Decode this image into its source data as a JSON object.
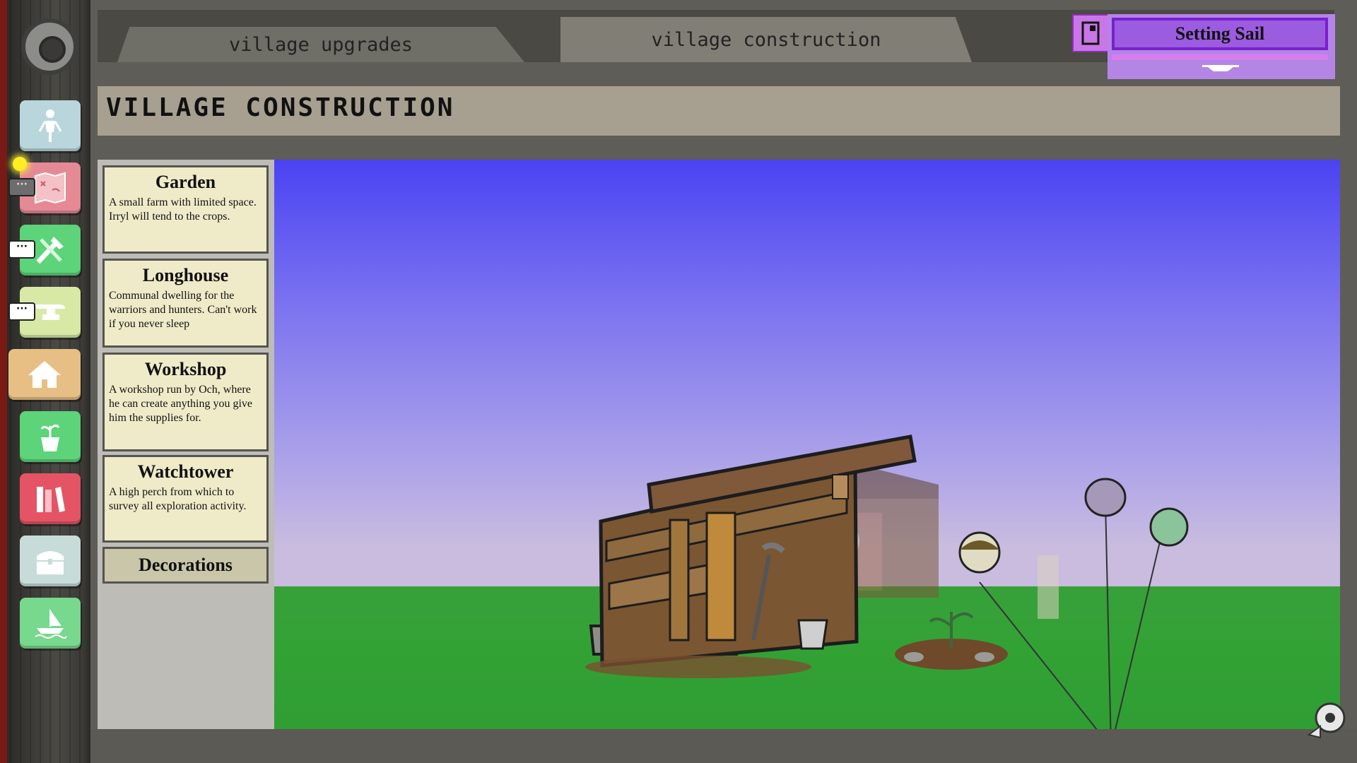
{
  "tabs": {
    "upgrades": "village upgrades",
    "construction": "village construction"
  },
  "quest": {
    "title": "Setting Sail"
  },
  "page": {
    "title": "VILLAGE CONSTRUCTION"
  },
  "buildings": [
    {
      "name": "Garden",
      "description": "A small farm with limited space. Irryl will tend to the crops."
    },
    {
      "name": "Longhouse",
      "description": "Communal dwelling for the warriors and hunters. Can't work if you never sleep"
    },
    {
      "name": "Workshop",
      "description": "A workshop run by Och, where he can create anything you give him the supplies for."
    },
    {
      "name": "Watchtower",
      "description": "A high perch from which to survey all exploration activity."
    }
  ],
  "decorations_label": "Decorations",
  "nav": [
    {
      "icon": "person-icon",
      "color": "#b9d6dd"
    },
    {
      "icon": "map-icon",
      "color": "#e58a95"
    },
    {
      "icon": "tools-icon",
      "color": "#5dd37a"
    },
    {
      "icon": "anvil-icon",
      "color": "#d8e9a6"
    },
    {
      "icon": "hut-icon",
      "color": "#e7bf85"
    },
    {
      "icon": "plant-pot-icon",
      "color": "#5dd37a"
    },
    {
      "icon": "books-icon",
      "color": "#e55465"
    },
    {
      "icon": "chest-icon",
      "color": "#c7dcd8"
    },
    {
      "icon": "boat-icon",
      "color": "#78d88e"
    }
  ],
  "bubbles": {
    "map": "···",
    "tools": "···",
    "anvil": "···"
  }
}
